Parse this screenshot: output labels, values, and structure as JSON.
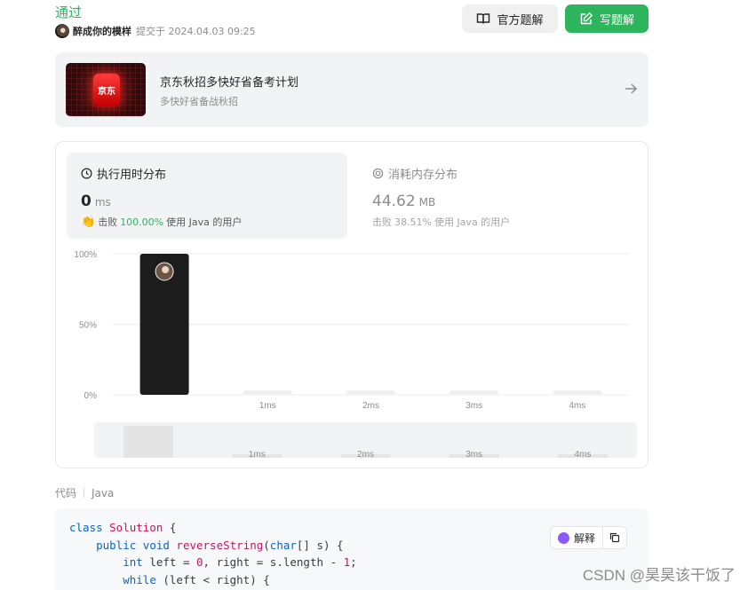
{
  "status": "通过",
  "submitter": {
    "name": "醉成你的模样",
    "submitted_text": "提交于 2024.04.03 09:25"
  },
  "actions": {
    "official_solution": "官方题解",
    "write_solution": "写题解"
  },
  "ad": {
    "logo_text": "京东",
    "title": "京东秋招多快好省备考计划",
    "subtitle": "多快好省备战秋招"
  },
  "runtime": {
    "title": "执行用时分布",
    "value": "0",
    "unit": "ms",
    "beat_label": "击败",
    "beat_pct": "100.00%",
    "beat_suffix": "使用 Java 的用户"
  },
  "memory": {
    "title": "消耗内存分布",
    "value": "44.62",
    "unit": "MB",
    "beat_label": "击败",
    "beat_pct": "38.51%",
    "beat_suffix": "使用 Java 的用户"
  },
  "chart_data": {
    "type": "bar",
    "categories": [
      "0ms",
      "1ms",
      "2ms",
      "3ms",
      "4ms"
    ],
    "x_tick_labels": [
      "",
      "1ms",
      "2ms",
      "3ms",
      "4ms"
    ],
    "values": [
      100,
      0,
      0,
      0,
      0
    ],
    "ylim": [
      0,
      100
    ],
    "y_ticks": [
      "100%",
      "50%",
      "0%"
    ],
    "highlight_index": 0,
    "colors": {
      "highlight": "#1c1c1c",
      "bar": "#efefef",
      "grid": "#ededed"
    },
    "navigator": {
      "tick_labels": [
        "1ms",
        "2ms",
        "3ms",
        "4ms"
      ],
      "values": [
        100,
        0,
        0,
        0,
        0
      ]
    }
  },
  "code_section": {
    "label": "代码",
    "language": "Java"
  },
  "code": {
    "lines": [
      [
        [
          "kw",
          "class "
        ],
        [
          "cls",
          "Solution"
        ],
        [
          "p",
          " {"
        ]
      ],
      [
        [
          "p",
          "    "
        ],
        [
          "kw",
          "public void "
        ],
        [
          "fn",
          "reverseString"
        ],
        [
          "p",
          "("
        ],
        [
          "kw",
          "char"
        ],
        [
          "p",
          "[] s) {"
        ]
      ],
      [
        [
          "p",
          "        "
        ],
        [
          "kw",
          "int "
        ],
        [
          "p",
          "left = "
        ],
        [
          "num",
          "0"
        ],
        [
          "p",
          ", right = s.length - "
        ],
        [
          "num",
          "1"
        ],
        [
          "p",
          ";"
        ]
      ],
      [
        [
          "p",
          "        "
        ],
        [
          "kw",
          "while "
        ],
        [
          "p",
          "(left < right) {"
        ]
      ]
    ],
    "explain_label": "解释"
  },
  "watermark": "CSDN @昊昊该干饭了"
}
